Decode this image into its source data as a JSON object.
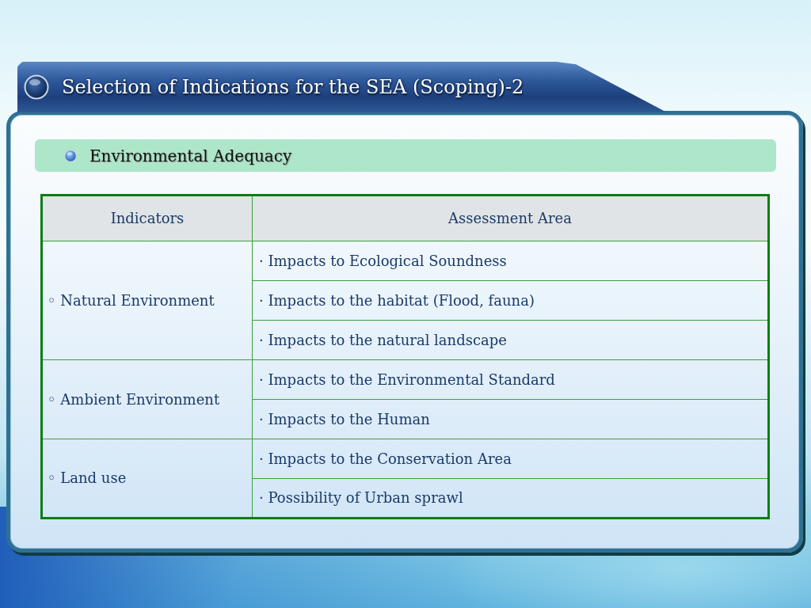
{
  "slide": {
    "title": "Selection of Indications for the SEA (Scoping)-2"
  },
  "section": {
    "heading": "Environmental Adequacy"
  },
  "table": {
    "columns": [
      "Indicators",
      "Assessment Area"
    ],
    "groups": [
      {
        "indicator": "◦ Natural Environment",
        "areas": [
          "· Impacts to Ecological Soundness",
          "· Impacts to the habitat (Flood, fauna)",
          "· Impacts to the natural landscape"
        ]
      },
      {
        "indicator": "◦ Ambient Environment",
        "areas": [
          "· Impacts to the Environmental Standard",
          "· Impacts to the Human"
        ]
      },
      {
        "indicator": "◦ Land use",
        "areas": [
          "· Impacts to the Conservation Area",
          "· Possibility of Urban sprawl"
        ]
      }
    ]
  }
}
